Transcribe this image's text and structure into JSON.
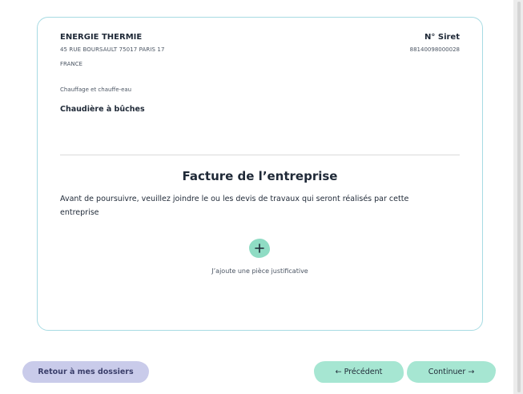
{
  "company": {
    "name": "ENERGIE THERMIE",
    "address": "45 RUE BOURSAULT 75017 PARIS 17",
    "country": "FRANCE",
    "siret_label": "N° Siret",
    "siret_number": "88140098000028",
    "category": "Chauffage et chauffe-eau",
    "equipment": "Chaudière à bûches"
  },
  "invoice_section": {
    "title": "Facture de l’entreprise",
    "description": "Avant de poursuivre, veuillez joindre le ou les devis de travaux qui seront réalisés par cette entreprise",
    "add_icon": "plus-icon",
    "add_label": "J’ajoute une pièce justificative"
  },
  "footer": {
    "back_label": "Retour à mes dossiers",
    "previous_label": "← Précédent",
    "continue_label": "Continuer →"
  },
  "colors": {
    "card_border": "#a7dbe3",
    "accent_green": "#a6e6d2",
    "back_button": "#c9cbea"
  }
}
